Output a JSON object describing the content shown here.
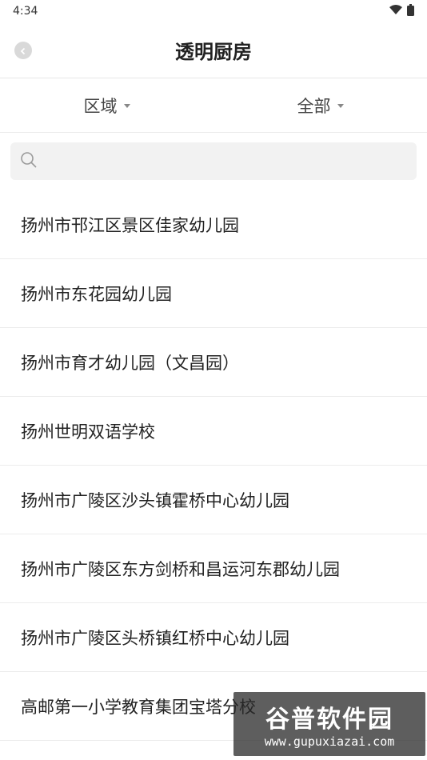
{
  "status": {
    "time": "4:34",
    "icons": [
      "wifi-icon",
      "battery-icon"
    ]
  },
  "header": {
    "title": "透明厨房",
    "back_icon": "chevron-left-icon"
  },
  "filters": [
    {
      "label": "区域"
    },
    {
      "label": "全部"
    }
  ],
  "search": {
    "placeholder": "",
    "value": "",
    "icon": "search-icon"
  },
  "list": [
    {
      "label": "扬州市邗江区景区佳家幼儿园"
    },
    {
      "label": "扬州市东花园幼儿园"
    },
    {
      "label": "扬州市育才幼儿园（文昌园）"
    },
    {
      "label": "扬州世明双语学校"
    },
    {
      "label": "扬州市广陵区沙头镇霍桥中心幼儿园"
    },
    {
      "label": "扬州市广陵区东方剑桥和昌运河东郡幼儿园"
    },
    {
      "label": "扬州市广陵区头桥镇红桥中心幼儿园"
    },
    {
      "label": "高邮第一小学教育集团宝塔分校"
    }
  ],
  "watermark": {
    "title": "谷普软件园",
    "url": "www.gupuxiazai.com"
  },
  "colors": {
    "background": "#ffffff",
    "divider": "#ececec",
    "search_bg": "#f2f2f2"
  }
}
